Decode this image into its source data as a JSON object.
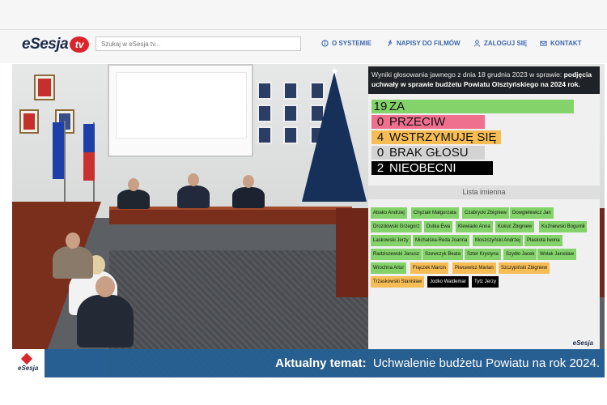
{
  "header": {
    "logo_text": "eSesja",
    "logo_tv": "tv",
    "search_placeholder": "Szukaj w eSesja tv...",
    "nav": {
      "about": "O SYSTEMIE",
      "subtitles": "NAPISY DO FILMÓW",
      "login": "ZALOGUJ SIĘ",
      "contact": "KONTAKT"
    }
  },
  "vote": {
    "header_prefix": "Wyniki głosowania jawnego z dnia 18 grudnia 2023 w sprawie:",
    "header_subject": "podjęcia uchwały w sprawie budżetu Powiatu Olsztyńskiego na 2024 rok.",
    "results": [
      {
        "count": "19",
        "label": "ZA",
        "color": "#84d36a"
      },
      {
        "count": "0",
        "label": "PRZECIW",
        "color": "#ef6f8f"
      },
      {
        "count": "4",
        "label": "WSTRZYMUJĘ SIĘ",
        "color": "#f7bd55"
      },
      {
        "count": "0",
        "label": "BRAK GŁOSU",
        "color": "#d3d3d3"
      },
      {
        "count": "2",
        "label": "NIEOBECNI",
        "color": "#000000"
      }
    ],
    "list_header": "Lista imienna",
    "names": [
      [
        "Abako Andrzej",
        "Chyziak Małgorzata",
        "Czabrycki Zbigniew",
        "Dowgielewicz Jan"
      ],
      [
        "Drozdowski Grzegorz",
        "Dutka Ewa",
        "Klewiado Anna",
        "Kukuć Zbigniew",
        "Kuźniewski Bogumił"
      ],
      [
        "Laskowski Jerzy",
        "Michalska-Reda Joanna",
        "Moszczyński Andrzej",
        "Plaskota Iwona"
      ],
      [
        "Radziszewski Janusz",
        "Szewczyk Beata",
        "Szter Krystyna",
        "Szydło Jacek",
        "Wolak Jarosław"
      ],
      [
        "Wrochna Artur",
        "Frączek Marcin",
        "Piwcewicz Marian",
        "Szczypiński Zbigniew"
      ],
      [
        "Trzaskowski Stanisław",
        "Jodko Waldemar",
        "Tytz Jerzy"
      ]
    ],
    "panel_logo": "eSesja"
  },
  "ticker": {
    "logo": "eSesja",
    "label": "Aktualny temat:",
    "topic": "Uchwalenie budżetu Powiatu na rok 2024."
  }
}
